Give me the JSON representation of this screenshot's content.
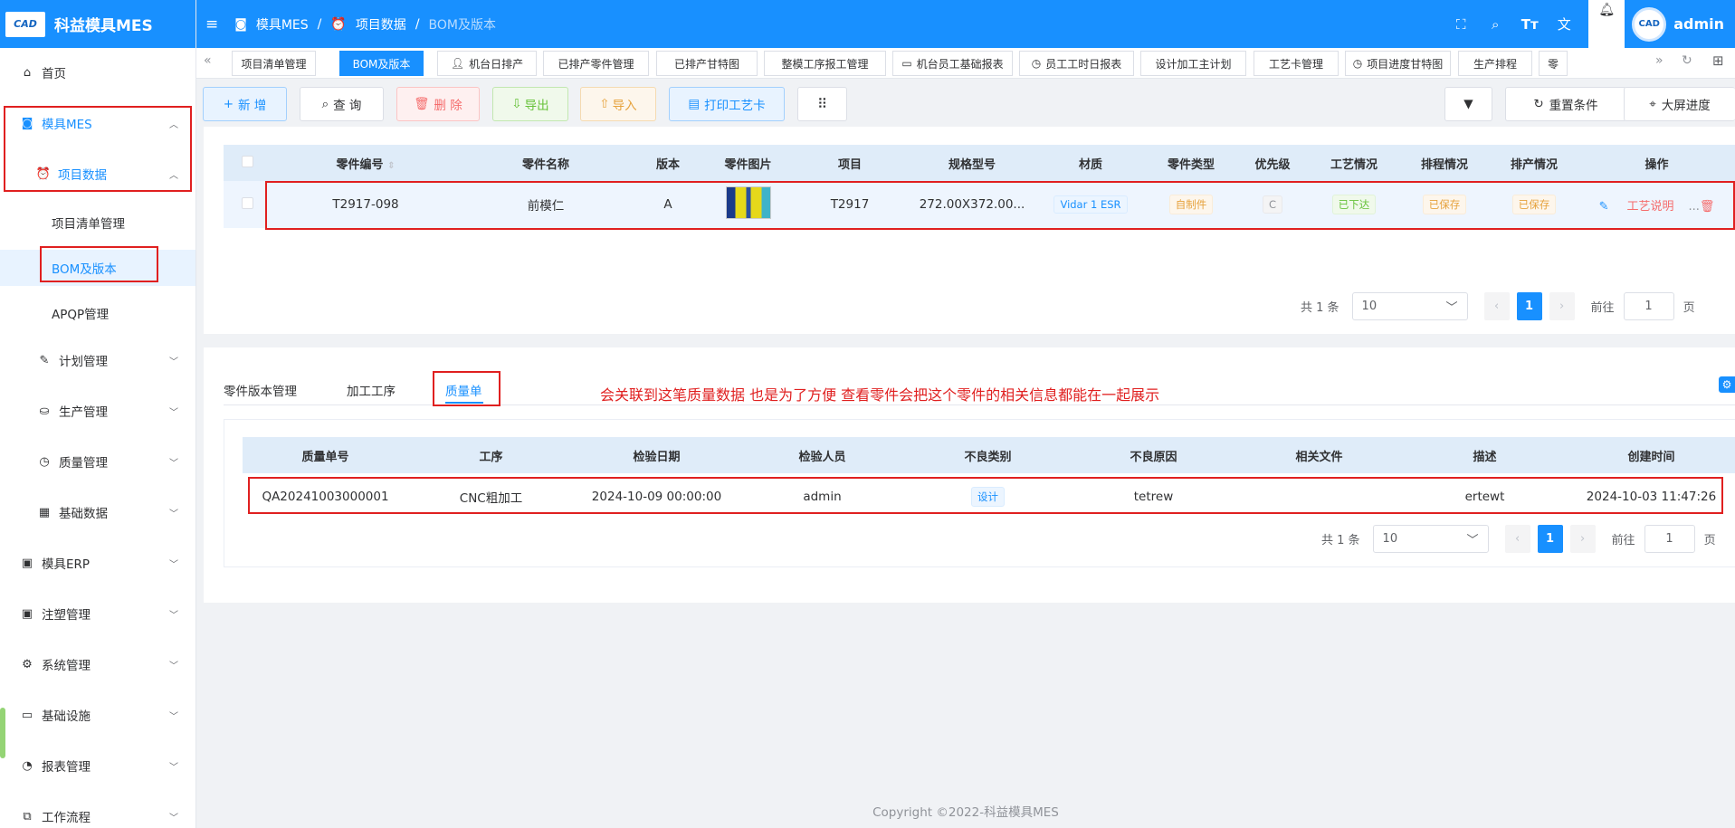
{
  "app": {
    "title": "科益模具MES",
    "logo_text": "CAD"
  },
  "sidebar": {
    "items": [
      {
        "label": "首页",
        "icon": "home-icon"
      },
      {
        "label": "模具MES",
        "icon": "camera-icon"
      },
      {
        "label": "项目数据",
        "icon": "alarm-clock-icon"
      },
      {
        "label": "项目清单管理"
      },
      {
        "label": "BOM及版本"
      },
      {
        "label": "APQP管理"
      },
      {
        "label": "计划管理",
        "icon": "edit-icon"
      },
      {
        "label": "生产管理",
        "icon": "box-icon"
      },
      {
        "label": "质量管理",
        "icon": "stopwatch-icon"
      },
      {
        "label": "基础数据",
        "icon": "calendar-icon"
      },
      {
        "label": "模具ERP",
        "icon": "suitcase-icon"
      },
      {
        "label": "注塑管理",
        "icon": "suitcase-icon"
      },
      {
        "label": "系统管理",
        "icon": "gear-icon"
      },
      {
        "label": "基础设施",
        "icon": "monitor-icon"
      },
      {
        "label": "报表管理",
        "icon": "pie-chart-icon"
      },
      {
        "label": "工作流程",
        "icon": "flow-icon"
      }
    ]
  },
  "topbar": {
    "breadcrumb": [
      "模具MES",
      "项目数据",
      "BOM及版本"
    ],
    "user": "admin"
  },
  "tabs": [
    "项目清单管理",
    "BOM及版本",
    "机台日排产",
    "已排产零件管理",
    "已排产甘特图",
    "整模工序报工管理",
    "机台员工基础报表",
    "员工工时日报表",
    "设计加工主计划",
    "工艺卡管理",
    "项目进度甘特图",
    "生产排程",
    "零"
  ],
  "toolbar": {
    "add": "新 增",
    "query": "查 询",
    "delete": "删 除",
    "export": "导出",
    "import": "导入",
    "print": "打印工艺卡",
    "reset": "重置条件",
    "bigscreen": "大屏进度"
  },
  "bom_table": {
    "headers": [
      "零件编号",
      "零件名称",
      "版本",
      "零件图片",
      "项目",
      "规格型号",
      "材质",
      "零件类型",
      "优先级",
      "工艺情况",
      "排程情况",
      "排产情况",
      "操作"
    ],
    "rows": [
      {
        "part_no": "T2917-098",
        "part_name": "前模仁",
        "version": "A",
        "project": "T2917",
        "spec": "272.00X372.00...",
        "material": "Vidar 1 ESR",
        "type": "自制件",
        "priority": "C",
        "process": "已下达",
        "schedule": "已保存",
        "production": "已保存",
        "op_label": "工艺说明",
        "op_more": "..."
      }
    ]
  },
  "pager1": {
    "total": "共 1 条",
    "size": "10",
    "page": "1",
    "goto": "前往",
    "goto_val": "1",
    "unit": "页"
  },
  "sub_tabs": [
    "零件版本管理",
    "加工工序",
    "质量单"
  ],
  "annotation": "会关联到这笔质量数据 也是为了方便 查看零件会把这个零件的相关信息都能在一起展示",
  "quality_table": {
    "headers": [
      "质量单号",
      "工序",
      "检验日期",
      "检验人员",
      "不良类别",
      "不良原因",
      "相关文件",
      "描述",
      "创建时间"
    ],
    "rows": [
      {
        "no": "QA20241003000001",
        "process": "CNC粗加工",
        "date": "2024-10-09 00:00:00",
        "inspector": "admin",
        "category": "设计",
        "reason": "tetrew",
        "file": "",
        "desc": "ertewt",
        "created": "2024-10-03 11:47:26"
      }
    ]
  },
  "pager2": {
    "total": "共 1 条",
    "size": "10",
    "page": "1",
    "goto": "前往",
    "goto_val": "1",
    "unit": "页"
  },
  "footer": "Copyright ©2022-科益模具MES",
  "colors": {
    "primary": "#1890ff",
    "danger": "#f56c6c",
    "success": "#67c23a",
    "warning": "#e6a23c",
    "annotation": "#e02020"
  }
}
